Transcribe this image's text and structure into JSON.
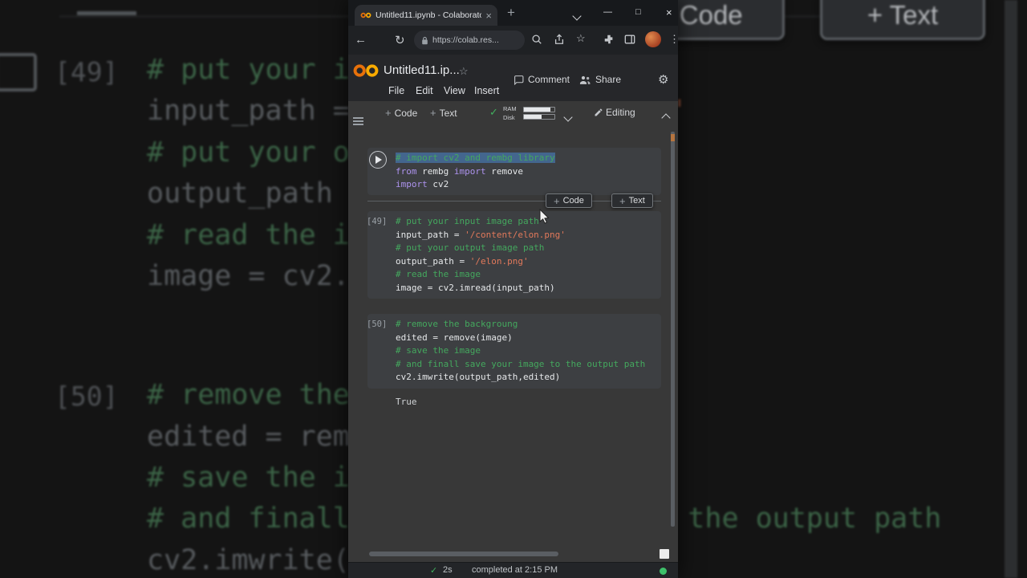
{
  "colors": {
    "colab_orange": "#F9AB00",
    "colab_orange_dark": "#E8710A",
    "comment_green": "#44a85e",
    "string_orange": "#e2795b",
    "keyword_purple": "#ad93ee",
    "run_green": "#41b05e",
    "status_dot_green": "#3ec06a",
    "selection_blue": "#4887cd"
  },
  "window": {
    "tab_title": "Untitled11.ipynb - Colaborato",
    "url": "https://colab.res..."
  },
  "glyphs": {
    "tab_close": "×",
    "new_tab": "+",
    "minimize": "—",
    "maximize": "□",
    "close": "×",
    "back": "←",
    "reload": "↻",
    "star": "☆",
    "gear": "⚙",
    "kebab": "⋮",
    "check": "✓",
    "plus": "+",
    "variables_icon": "{x}",
    "prompt": ">",
    "dot": "●"
  },
  "header": {
    "title": "Untitled11.ip...",
    "comment_label": "Comment",
    "share_label": "Share",
    "menu": [
      "File",
      "Edit",
      "View",
      "Insert"
    ]
  },
  "toolbar": {
    "add_code": "Code",
    "add_text": "Text",
    "ram_label": "RAM",
    "disk_label": "Disk",
    "editing_label": "Editing"
  },
  "inline_insert": {
    "code": "Code",
    "text": "Text"
  },
  "notebook": {
    "cell1_lines": [
      [
        {
          "t": "# import cv2 and rembg library",
          "c": "cm",
          "sel": true
        }
      ],
      [
        {
          "t": "from",
          "c": "kw"
        },
        {
          "t": " rembg ",
          "c": "p"
        },
        {
          "t": "import",
          "c": "kw"
        },
        {
          "t": " remove",
          "c": "p"
        }
      ],
      [
        {
          "t": "import",
          "c": "kw"
        },
        {
          "t": " cv2",
          "c": "p"
        }
      ]
    ],
    "cell2_exec": "[49]",
    "cell2_lines": [
      [
        {
          "t": "# put your input image path",
          "c": "cm"
        }
      ],
      [
        {
          "t": "input_path = ",
          "c": "p"
        },
        {
          "t": "'/content/elon.png'",
          "c": "str"
        }
      ],
      [
        {
          "t": "# put your output image path",
          "c": "cm"
        }
      ],
      [
        {
          "t": "output_path = ",
          "c": "p"
        },
        {
          "t": "'/elon.png'",
          "c": "str"
        }
      ],
      [
        {
          "t": "# read the image",
          "c": "cm"
        }
      ],
      [
        {
          "t": "image = cv2.imread(input_path)",
          "c": "p"
        }
      ]
    ],
    "cell3_exec": "[50]",
    "cell3_lines": [
      [
        {
          "t": "# remove the backgroung",
          "c": "cm"
        }
      ],
      [
        {
          "t": "edited = remove(image)",
          "c": "p"
        }
      ],
      [
        {
          "t": "# save the image",
          "c": "cm"
        }
      ],
      [
        {
          "t": "# and finall save your image to the output path",
          "c": "cm"
        }
      ],
      [
        {
          "t": "cv2.imwrite(output_path,edited)",
          "c": "p"
        }
      ]
    ],
    "cell3_output": "True"
  },
  "status": {
    "duration": "2s",
    "completed": "completed at 2:15 PM"
  },
  "bg": {
    "gutter49": "[49]",
    "gutter50": "[50]",
    "btn_code": "+ Code",
    "btn_text": "+ Text"
  }
}
